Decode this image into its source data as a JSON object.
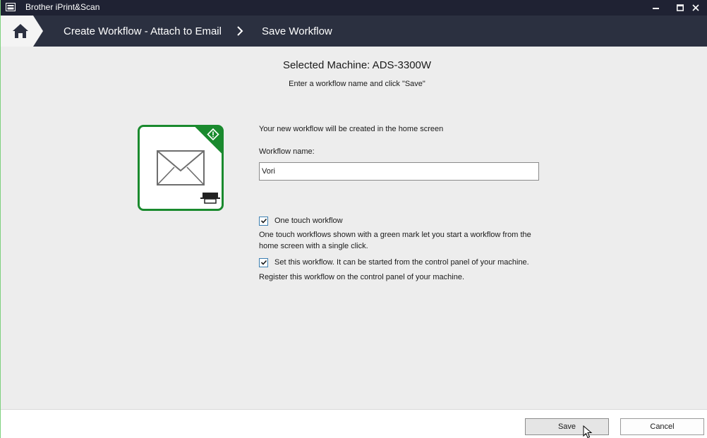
{
  "window": {
    "title": "Brother iPrint&Scan"
  },
  "nav": {
    "breadcrumbs": [
      "Create Workflow - Attach to Email",
      "Save Workflow"
    ]
  },
  "main": {
    "heading": "Selected Machine: ADS-3300W",
    "subheading": "Enter a workflow name and click \"Save\"",
    "info_text": "Your new workflow will be created in the home screen",
    "name_label": "Workflow name:",
    "name_value": "Vori",
    "one_touch": {
      "label": "One touch workflow",
      "checked": true,
      "description_line1": "One touch workflows shown with a green mark let you start a workflow from the",
      "description_line2": "home screen with a single click."
    },
    "set_workflow": {
      "label": "Set this workflow. It can be started from the control panel of your machine.",
      "checked": true,
      "description": "Register this workflow on the control panel of your machine."
    },
    "tile": {
      "icon": "email-envelope-icon",
      "badge_icon": "one-touch-diamond-icon",
      "device_icon": "printer-icon",
      "accent_color": "#1a8a2e"
    }
  },
  "footer": {
    "save_label": "Save",
    "cancel_label": "Cancel"
  },
  "colors": {
    "titlebar": "#1f2233",
    "navbar": "#2b3040",
    "background": "#ededed",
    "accent_green": "#1a8a2e",
    "checkbox_border": "#3c7fb1"
  }
}
